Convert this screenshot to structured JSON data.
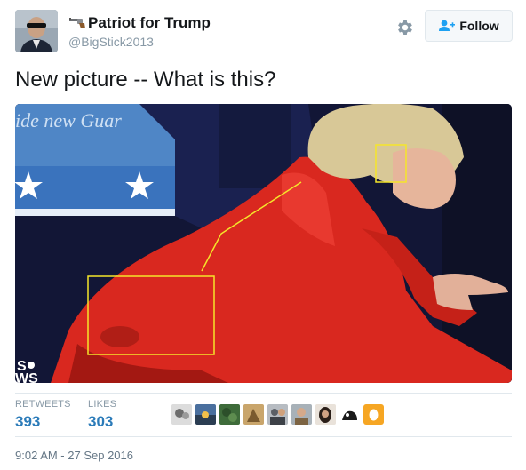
{
  "author": {
    "display_name": "Patriot for Trump",
    "handle": "@BigStick2013"
  },
  "actions": {
    "follow_label": "Follow"
  },
  "tweet": {
    "text": "New picture -- What is this?",
    "photo": {
      "banner_text": "ide new Guar",
      "logo_text_top": "S",
      "logo_text_bottom": "WS"
    }
  },
  "stats": {
    "retweets_label": "RETWEETS",
    "retweets_value": "393",
    "likes_label": "LIKES",
    "likes_value": "303"
  },
  "likers": [
    "avatar-1",
    "avatar-2",
    "avatar-3",
    "avatar-4",
    "avatar-5",
    "avatar-6",
    "avatar-7",
    "avatar-8",
    "avatar-9"
  ],
  "timestamp": "9:02 AM - 27 Sep 2016",
  "colors": {
    "link_blue": "#2b7bb9",
    "muted_gray": "#8899a6",
    "follow_icon_blue": "#1da1f2",
    "jacket_red": "#d9281f",
    "annotation_yellow": "#f5e52a"
  }
}
